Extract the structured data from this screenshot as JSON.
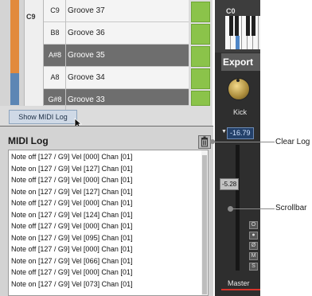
{
  "groove_list": {
    "pad_label": "C9",
    "rows": [
      {
        "note": "C9",
        "name": "Groove 37",
        "style": "light"
      },
      {
        "note": "B8",
        "name": "Groove 36",
        "style": "light"
      },
      {
        "note": "A#8",
        "name": "Groove 35",
        "style": "dark"
      },
      {
        "note": "A8",
        "name": "Groove 34",
        "style": "light"
      },
      {
        "note": "G#8",
        "name": "Groove 33",
        "style": "dark"
      }
    ],
    "show_midi_log_button": "Show MIDI Log"
  },
  "mixer": {
    "keyboard_label": "C0",
    "channel_name": "Export",
    "knob_label": "Kick",
    "volume_value": "-16.79",
    "fader_value": "-5.28",
    "channel_buttons": [
      "O",
      "●",
      "Ø",
      "M",
      "S"
    ],
    "master_label": "Master"
  },
  "midi_log": {
    "title": "MIDI Log",
    "lines": [
      "Note off [127 / G9]  Vel [000] Chan [01]",
      "Note on  [127 / G9]  Vel [127] Chan [01]",
      "Note off [127 / G9]  Vel [000] Chan [01]",
      "Note on  [127 / G9]  Vel [127] Chan [01]",
      "Note off [127 / G9]  Vel [000] Chan [01]",
      "Note on  [127 / G9]  Vel [124] Chan [01]",
      "Note off [127 / G9]  Vel [000] Chan [01]",
      "Note on  [127 / G9]  Vel [095] Chan [01]",
      "Note off [127 / G9]  Vel [000] Chan [01]",
      "Note on  [127 / G9]  Vel [066] Chan [01]",
      "Note off [127 / G9]  Vel [000] Chan [01]",
      "Note on  [127 / G9]  Vel [073] Chan [01]"
    ]
  },
  "callouts": {
    "clear_log": "Clear Log",
    "scrollbar": "Scrollbar"
  },
  "colors": {
    "accent_green": "#8bc34a",
    "orange_bar": "#e28a3c",
    "volume_blue": "#24416a",
    "master_red": "#d9342b"
  }
}
